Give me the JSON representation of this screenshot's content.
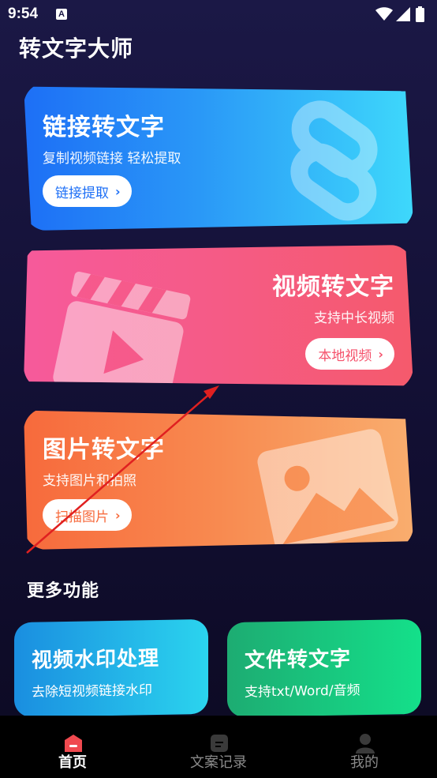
{
  "status_bar": {
    "time": "9:54",
    "notification_letter": "A"
  },
  "app": {
    "title": "转文字大师"
  },
  "cards": {
    "link": {
      "title": "链接转文字",
      "subtitle": "复制视频链接 轻松提取",
      "button": "链接提取",
      "color": "#1d6ff6"
    },
    "video": {
      "title": "视频转文字",
      "subtitle": "支持中长视频",
      "button": "本地视频",
      "color": "#f55a86"
    },
    "image": {
      "title": "图片转文字",
      "subtitle": "支持图片和拍照",
      "button": "扫描图片",
      "color": "#f76a3c"
    }
  },
  "more": {
    "title": "更多功能",
    "watermark": {
      "title": "视频水印处理",
      "subtitle": "去除短视频链接水印"
    },
    "file": {
      "title": "文件转文字",
      "subtitle": "支持txt/Word/音频"
    }
  },
  "tabs": [
    {
      "label": "首页",
      "icon": "home-icon",
      "active": true
    },
    {
      "label": "文案记录",
      "icon": "document-icon",
      "active": false
    },
    {
      "label": "我的",
      "icon": "user-icon",
      "active": false
    }
  ],
  "colors": {
    "active_tab": "#ffffff",
    "inactive_tab": "#8a8a8a",
    "tab_icon_active": "#f0494f",
    "annotation_arrow": "#e02020"
  }
}
